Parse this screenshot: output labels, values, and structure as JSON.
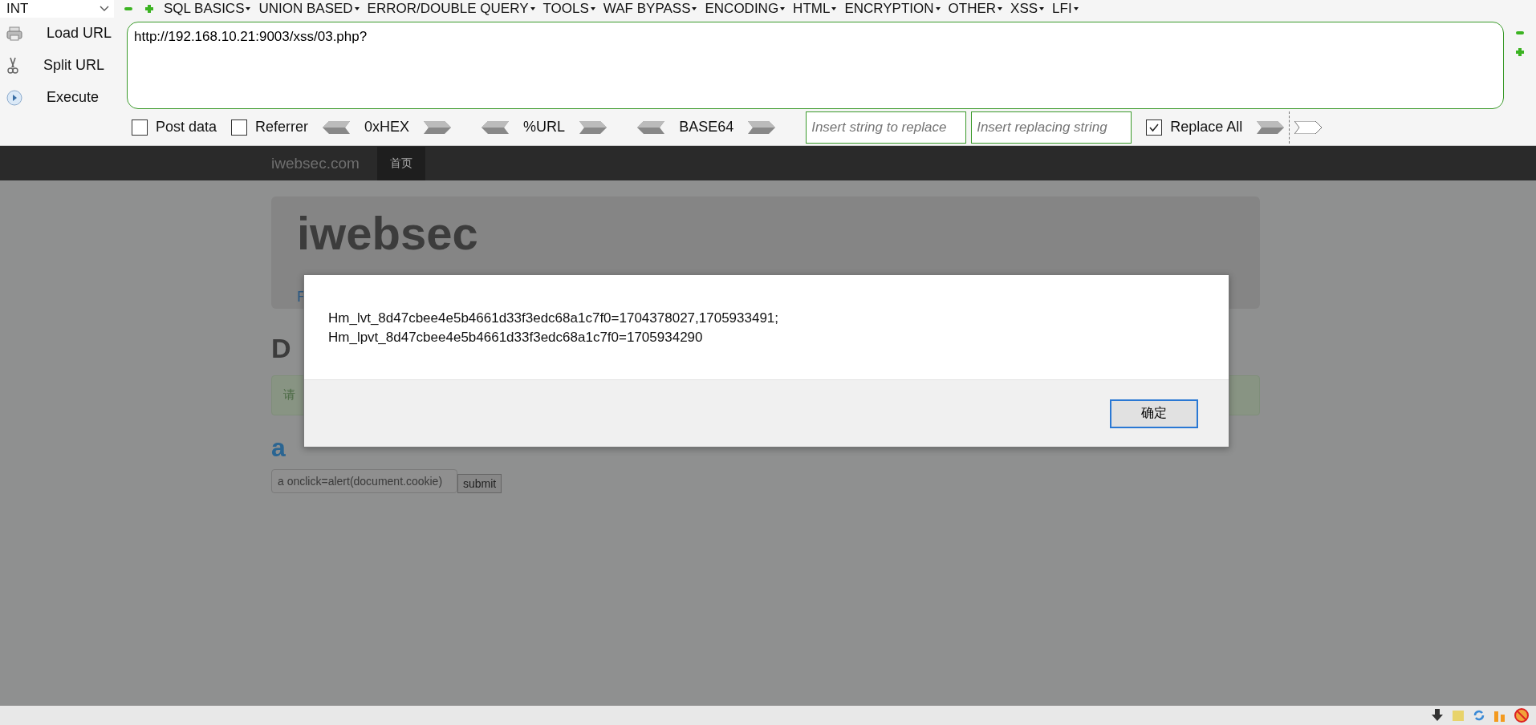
{
  "toolbar": {
    "select": "INT",
    "menus": [
      "SQL BASICS",
      "UNION BASED",
      "ERROR/DOUBLE QUERY",
      "TOOLS",
      "WAF BYPASS",
      "ENCODING",
      "HTML",
      "ENCRYPTION",
      "OTHER",
      "XSS",
      "LFI"
    ]
  },
  "side_buttons": [
    {
      "kind": "load",
      "label": "Load URL"
    },
    {
      "kind": "split",
      "label": "Split URL"
    },
    {
      "kind": "execute",
      "label": "Execute"
    }
  ],
  "url": "http://192.168.10.21:9003/xss/03.php?",
  "options": [
    {
      "label": "Post data",
      "checked": false
    },
    {
      "label": "Referrer",
      "checked": false
    }
  ],
  "encoders": [
    "0xHEX",
    "%URL",
    "BASE64"
  ],
  "replace": {
    "find_placeholder": "Insert string to replace",
    "replace_placeholder": "Insert replacing string",
    "replace_all": {
      "label": "Replace All",
      "checked": true
    }
  },
  "page": {
    "brand": "iwebsec.com",
    "nav": [
      {
        "label": "首页",
        "selected": true
      }
    ],
    "jumbotron": {
      "title": "iwebsec",
      "link": "F"
    },
    "heading": "D",
    "note": "请",
    "link": "a",
    "input_value": "a onclick=alert(document.cookie)",
    "submit": "submit"
  },
  "dialog": {
    "lines": [
      "Hm_lvt_8d47cbee4e5b4661d33f3edc68a1c7f0=1704378027,1705933491;",
      "Hm_lpvt_8d47cbee4e5b4661d33f3edc68a1c7f0=1705934290"
    ],
    "button": "确定"
  }
}
